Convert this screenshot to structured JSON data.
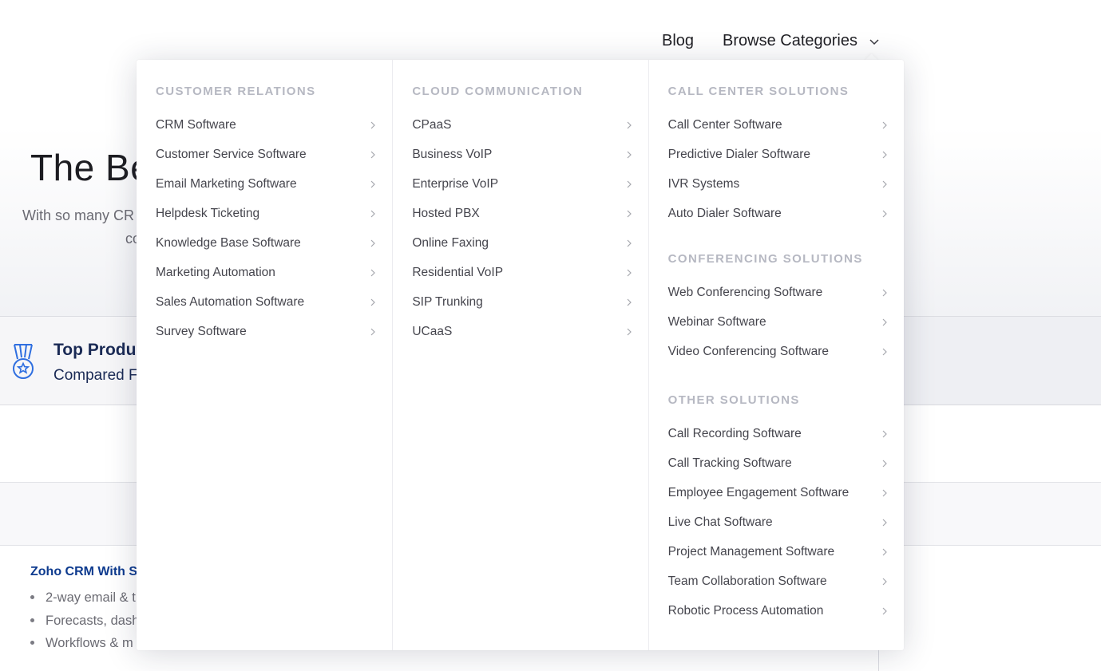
{
  "nav": {
    "blog": "Blog",
    "browse_categories": "Browse Categories"
  },
  "background": {
    "hero_title": "The Be",
    "hero_subtitle": "With so many CR",
    "hero_subtitle_line2": "co",
    "awards_title": "Top Produc",
    "awards_subtitle": "Compared Fo",
    "product_title": "Zoho CRM With S",
    "product_features": [
      "2-way email & t",
      "Forecasts, dash",
      "Workflows & m"
    ]
  },
  "menu": {
    "columns": [
      {
        "groups": [
          {
            "heading": "Customer Relations",
            "items": [
              "CRM Software",
              "Customer Service Software",
              "Email Marketing Software",
              "Helpdesk Ticketing",
              "Knowledge Base Software",
              "Marketing Automation",
              "Sales Automation Software",
              "Survey Software"
            ]
          }
        ]
      },
      {
        "groups": [
          {
            "heading": "Cloud Communication",
            "items": [
              "CPaaS",
              "Business VoIP",
              "Enterprise VoIP",
              "Hosted PBX",
              "Online Faxing",
              "Residential VoIP",
              "SIP Trunking",
              "UCaaS"
            ]
          }
        ]
      },
      {
        "groups": [
          {
            "heading": "Call Center Solutions",
            "items": [
              "Call Center Software",
              "Predictive Dialer Software",
              "IVR Systems",
              "Auto Dialer Software"
            ]
          },
          {
            "heading": "Conferencing Solutions",
            "items": [
              "Web Conferencing Software",
              "Webinar Software",
              "Video Conferencing Software"
            ]
          },
          {
            "heading": "Other Solutions",
            "items": [
              "Call Recording Software",
              "Call Tracking Software",
              "Employee Engagement Software",
              "Live Chat Software",
              "Project Management Software",
              "Team Collaboration Software",
              "Robotic Process Automation"
            ]
          }
        ]
      }
    ]
  },
  "colors": {
    "accent_blue": "#0d3a8e",
    "heading_gray": "#b6b8c2",
    "item_text": "#45454d",
    "medal_blue": "#2f6fe0"
  }
}
